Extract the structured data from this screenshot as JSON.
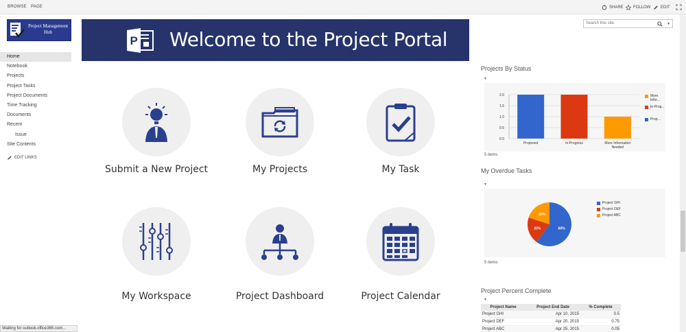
{
  "ribbon": {
    "tabs": [
      "BROWSE",
      "PAGE"
    ],
    "actions": {
      "share": "SHARE",
      "follow": "FOLLOW",
      "edit": "EDIT"
    }
  },
  "logo": {
    "text": "Project Management Hub"
  },
  "nav": {
    "items": [
      {
        "label": "Home",
        "selected": true
      },
      {
        "label": "Notebook"
      },
      {
        "label": "Projects"
      },
      {
        "label": "Project Tasks"
      },
      {
        "label": "Project Documents"
      },
      {
        "label": "Time Tracking"
      },
      {
        "label": "Documents"
      },
      {
        "label": "Recent"
      },
      {
        "label": "Issue",
        "indent": true
      },
      {
        "label": "Site Contents"
      }
    ],
    "edit_links": "EDIT LINKS"
  },
  "banner": {
    "title": "Welcome to the Project Portal"
  },
  "tiles": [
    {
      "label": "Submit a New Project",
      "icon": "lightbulb-person-icon"
    },
    {
      "label": "My Projects",
      "icon": "folder-sync-icon"
    },
    {
      "label": "My Task",
      "icon": "clipboard-check-icon"
    },
    {
      "label": "My Workspace",
      "icon": "sliders-icon"
    },
    {
      "label": "Project Dashboard",
      "icon": "org-chart-icon"
    },
    {
      "label": "Project Calendar",
      "icon": "calendar-icon"
    }
  ],
  "search": {
    "placeholder": "Search this site"
  },
  "status_chart": {
    "title": "Projects By Status",
    "items": "5 items",
    "chart_data": {
      "type": "bar",
      "categories": [
        "Proposed",
        "In-Progress",
        "More Information Needed"
      ],
      "values": [
        2,
        2,
        1
      ],
      "ylim": [
        0,
        2
      ],
      "yticks": [
        "0.0",
        "0.5",
        "1.0",
        "1.5",
        "2.0"
      ],
      "colors": [
        "#3366cc",
        "#dc3912",
        "#ff9900"
      ],
      "legend": [
        "More Infor...",
        "In-Prog...",
        "Prop..."
      ],
      "legend_colors": [
        "#ff9900",
        "#dc3912",
        "#3366cc"
      ],
      "grid": true,
      "legend_position": "right"
    }
  },
  "overdue_chart": {
    "title": "My Overdue Tasks",
    "items": "5 items",
    "chart_data": {
      "type": "pie",
      "categories": [
        "Project GHI",
        "Project DEF",
        "Project ABC"
      ],
      "values": [
        60,
        20,
        20
      ],
      "labels": [
        "60%",
        "20%",
        "20%"
      ],
      "colors": [
        "#3366cc",
        "#dc3912",
        "#ff9900"
      ],
      "legend_position": "right"
    }
  },
  "percent_table": {
    "title": "Project Percent Complete",
    "columns": [
      "Project Name",
      "Project End Date",
      "% Complete"
    ],
    "rows": [
      [
        "Project GHI",
        "Apr 10, 2015",
        "0.5"
      ],
      [
        "Project DEF",
        "Apr 20, 2015",
        "0.75"
      ],
      [
        "Project ABC",
        "Apr 25, 2015",
        "0.05"
      ]
    ]
  },
  "status_bar": {
    "text": "Waiting for outlook.office365.com..."
  }
}
